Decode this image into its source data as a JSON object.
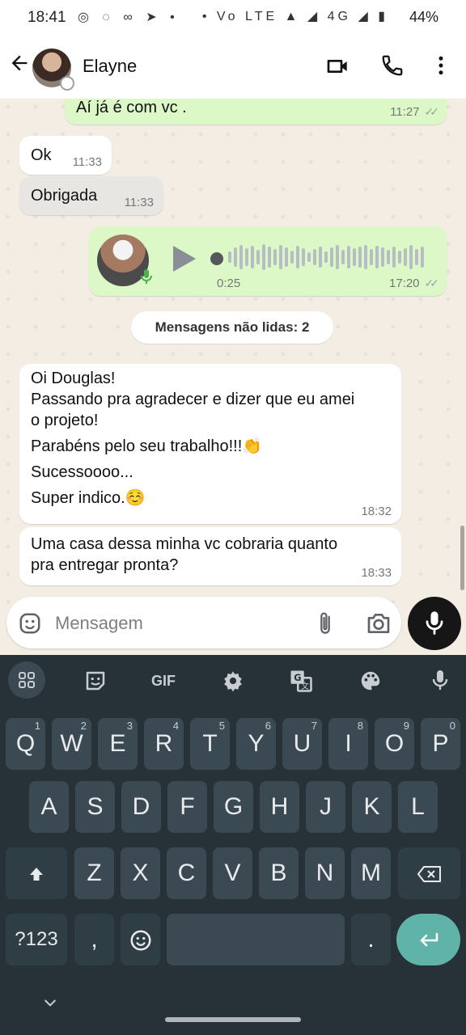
{
  "status_bar": {
    "time": "18:41",
    "left_icons": "◎ ◌ ∞ ➤ •",
    "right_icons": "• Vo LTE ▲ ◢ 4G ◢ ▮",
    "battery": "44%"
  },
  "header": {
    "contact_name": "Elayne",
    "back_icon": "arrow-left",
    "actions": [
      "video-call-icon",
      "phone-icon",
      "more-vert-icon"
    ]
  },
  "messages": [
    {
      "direction": "out",
      "text": "Aí já é com vc .",
      "time": "11:27",
      "ticks": "✓✓"
    },
    {
      "direction": "in",
      "text": "Ok",
      "time": "11:33"
    },
    {
      "direction": "in",
      "text": "Obrigada",
      "time": "11:33"
    },
    {
      "direction": "out",
      "type": "voice",
      "duration": "0:25",
      "time": "17:20",
      "ticks": "✓✓"
    },
    {
      "direction": "in",
      "lines": [
        "Oi Douglas!",
        "Passando pra agradecer e dizer que eu amei",
        "o projeto!",
        "Parabéns pelo seu trabalho!!!👏",
        "Sucessoooo...",
        "Super indico.☺️"
      ],
      "time": "18:32"
    },
    {
      "direction": "in",
      "lines": [
        "Uma casa dessa minha vc cobraria quanto",
        "pra entregar pronta?"
      ],
      "time": "18:33"
    }
  ],
  "unread_banner": "Mensagens não lidas: 2",
  "composer": {
    "placeholder": "Mensagem",
    "icons": [
      "emoji-icon",
      "attach-icon",
      "camera-icon",
      "mic-icon"
    ]
  },
  "keyboard": {
    "toolbar": {
      "gif": "GIF",
      "icons": [
        "apps-icon",
        "sticker-icon",
        "settings-icon",
        "translate-icon",
        "palette-icon",
        "mic-icon"
      ]
    },
    "row1": [
      {
        "k": "Q",
        "n": "1"
      },
      {
        "k": "W",
        "n": "2"
      },
      {
        "k": "E",
        "n": "3"
      },
      {
        "k": "R",
        "n": "4"
      },
      {
        "k": "T",
        "n": "5"
      },
      {
        "k": "Y",
        "n": "6"
      },
      {
        "k": "U",
        "n": "7"
      },
      {
        "k": "I",
        "n": "8"
      },
      {
        "k": "O",
        "n": "9"
      },
      {
        "k": "P",
        "n": "0"
      }
    ],
    "row2": [
      "A",
      "S",
      "D",
      "F",
      "G",
      "H",
      "J",
      "K",
      "L"
    ],
    "row3": [
      "Z",
      "X",
      "C",
      "V",
      "B",
      "N",
      "M"
    ],
    "bottom": {
      "symbols": "?123",
      "comma": ",",
      "period": "."
    }
  }
}
